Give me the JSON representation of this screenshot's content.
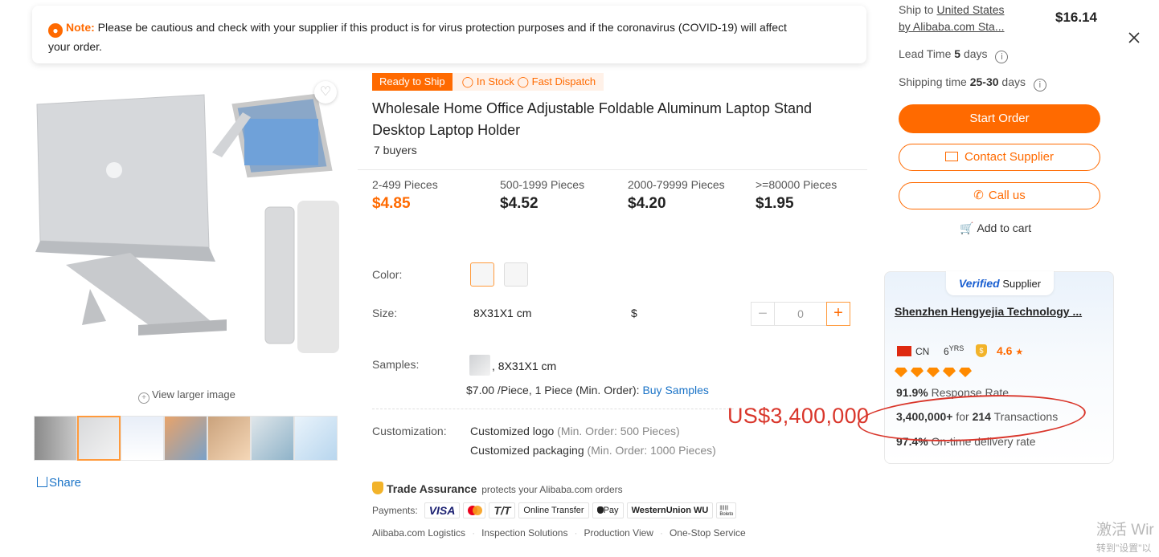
{
  "notice": {
    "icon": "lightbulb-icon",
    "label": "Note:",
    "text": "Please be cautious and check with your supplier if this product is for virus protection purposes and if the coronavirus (COVID-19) will affect your order."
  },
  "gallery": {
    "view_larger": "View larger image",
    "share": "Share",
    "thumb_count": 7
  },
  "product": {
    "tag_ready": "Ready to Ship",
    "tag_stock": "In Stock",
    "tag_dispatch": "Fast Dispatch",
    "title": "Wholesale Home Office Adjustable Foldable Aluminum Laptop Stand Desktop Laptop Holder",
    "buyers": "7 buyers",
    "tiers": [
      {
        "qty": "2-499 Pieces",
        "price": "$4.85"
      },
      {
        "qty": "500-1999 Pieces",
        "price": "$4.52"
      },
      {
        "qty": "2000-79999 Pieces",
        "price": "$4.20"
      },
      {
        "qty": ">=80000 Pieces",
        "price": "$1.95"
      }
    ],
    "color_label": "Color:",
    "size_label": "Size:",
    "size_value": "8X31X1 cm",
    "size_price": "$",
    "quantity": "0",
    "samples_label": "Samples:",
    "samples_size": ", 8X31X1 cm",
    "samples_price": "$7.00 /Piece, 1 Piece (Min. Order):",
    "buy_samples": "Buy Samples",
    "customization_label": "Customization:",
    "custom_logo": "Customized logo",
    "custom_logo_min": "(Min. Order: 500 Pieces)",
    "custom_pack": "Customized packaging",
    "custom_pack_min": "(Min. Order: 1000 Pieces)",
    "trade_assurance": "Trade Assurance",
    "trade_desc": "protects your Alibaba.com orders",
    "payments_label": "Payments:",
    "payments": [
      "VISA",
      "T/T",
      "Online Transfer",
      "Pay",
      "WesternUnion WU",
      "Boleto"
    ],
    "services": [
      "Alibaba.com Logistics",
      "Inspection Solutions",
      "Production View",
      "One-Stop Service"
    ]
  },
  "annotation": {
    "amount": "US$3,400,000",
    "color": "#d9362b"
  },
  "order": {
    "ship_to_prefix": "Ship to",
    "ship_to_country": "United States",
    "ship_by": "by Alibaba.com Sta...",
    "ship_cost": "$16.14",
    "lead_time_label": "Lead Time",
    "lead_time_value": "5",
    "lead_time_unit": "days",
    "shipping_time_label": "Shipping time",
    "shipping_time_value": "25-30",
    "shipping_time_unit": "days",
    "start_order": "Start Order",
    "contact_supplier": "Contact Supplier",
    "call_us": "Call us",
    "add_to_cart": "Add to cart",
    "accent": "#ff6a00"
  },
  "supplier": {
    "badge_verified": "Verified",
    "badge_supplier": "Supplier",
    "name": "Shenzhen Hengyejia Technology ...",
    "country": "CN",
    "years": "6",
    "years_unit": "YRS",
    "rating": "4.6",
    "diamonds": 5,
    "response_rate_value": "91.9%",
    "response_rate_label": "Response Rate",
    "transactions_amount": "3,400,000+",
    "transactions_mid": "for",
    "transactions_count": "214",
    "transactions_label": "Transactions",
    "delivery_value": "97.4%",
    "delivery_label": "On-time delivery rate"
  },
  "watermark": {
    "line1": "激活 Wir",
    "line2": "转到\"设置\"以"
  }
}
